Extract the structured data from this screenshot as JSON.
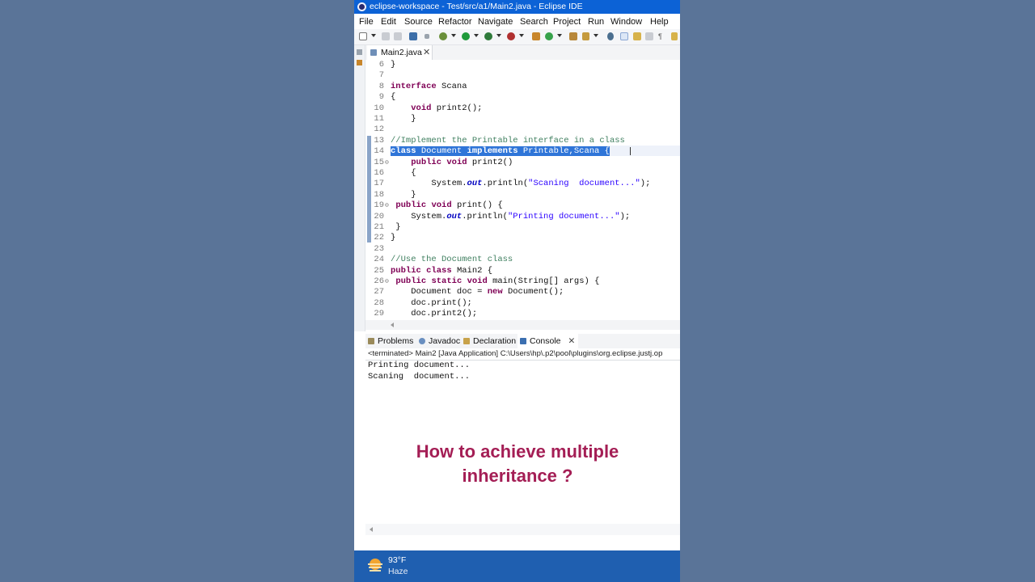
{
  "window": {
    "title": "eclipse-workspace - Test/src/a1/Main2.java - Eclipse IDE"
  },
  "menu": [
    "File",
    "Edit",
    "Source",
    "Refactor",
    "Navigate",
    "Search",
    "Project",
    "Run",
    "Window",
    "Help"
  ],
  "toolbar_icons": [
    "new-icon",
    "save-icon",
    "save-all-icon",
    "print-icon",
    "debug-icon",
    "run-icon",
    "coverage-icon",
    "external-tools-icon",
    "new-java-project-icon",
    "new-class-icon",
    "open-type-icon",
    "search-icon",
    "toggle-mark-occurrences-icon",
    "annotation-icon",
    "show-whitespace-icon"
  ],
  "editor": {
    "tab_label": "Main2.java",
    "code": [
      {
        "n": "6",
        "text": "}"
      },
      {
        "n": "7",
        "text": ""
      },
      {
        "n": "8",
        "text": "interface Scana"
      },
      {
        "n": "9",
        "text": "{"
      },
      {
        "n": "10",
        "text": "    void print2();"
      },
      {
        "n": "11",
        "text": "    }"
      },
      {
        "n": "12",
        "text": ""
      },
      {
        "n": "13",
        "text": "//Implement the Printable interface in a class"
      },
      {
        "n": "14",
        "text": "class Document implements Printable,Scana {"
      },
      {
        "n": "15",
        "text": "    public void print2()"
      },
      {
        "n": "16",
        "text": "    {"
      },
      {
        "n": "17",
        "text": "        System.out.println(\"Scaning  document...\");"
      },
      {
        "n": "18",
        "text": "    }"
      },
      {
        "n": "19",
        "text": " public void print() {"
      },
      {
        "n": "20",
        "text": "    System.out.println(\"Printing document...\");"
      },
      {
        "n": "21",
        "text": " }"
      },
      {
        "n": "22",
        "text": "}"
      },
      {
        "n": "23",
        "text": ""
      },
      {
        "n": "24",
        "text": "//Use the Document class"
      },
      {
        "n": "25",
        "text": "public class Main2 {"
      },
      {
        "n": "26",
        "text": " public static void main(String[] args) {"
      },
      {
        "n": "27",
        "text": "    Document doc = new Document();"
      },
      {
        "n": "28",
        "text": "    doc.print();"
      },
      {
        "n": "29",
        "text": "    doc.print2();"
      }
    ]
  },
  "console": {
    "tabs": [
      {
        "label": "Problems",
        "icon": "problems-icon"
      },
      {
        "label": "Javadoc",
        "icon": "javadoc-icon"
      },
      {
        "label": "Declaration",
        "icon": "declaration-icon"
      },
      {
        "label": "Console",
        "icon": "console-icon",
        "active": true
      }
    ],
    "status": "<terminated> Main2 [Java Application] C:\\Users\\hp\\.p2\\pool\\plugins\\org.eclipse.justj.op",
    "output": [
      "Printing document...",
      "Scaning  document..."
    ]
  },
  "caption": {
    "line1": "How to achieve multiple",
    "line2": "inheritance ?",
    "color": "#a41e55"
  },
  "taskbar": {
    "temperature": "93°F",
    "condition": "Haze",
    "weather_icon": "haze-sun-icon"
  },
  "colors": {
    "background": "#5a7498",
    "titlebar": "#0c62d6",
    "selection": "#2f75d8",
    "keyword": "#7f0055",
    "comment": "#3f7f5f",
    "string": "#2a00ff"
  }
}
